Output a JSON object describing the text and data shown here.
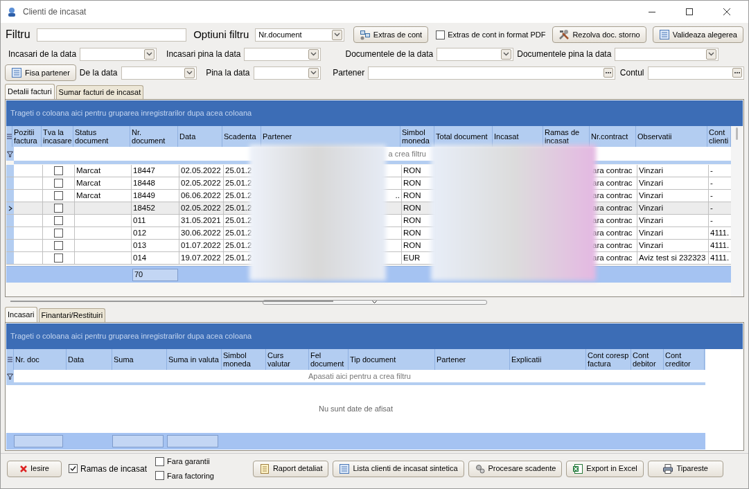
{
  "window": {
    "title": "Clienti de incasat"
  },
  "filter_bar": {
    "filter_label": "Filtru",
    "options_label": "Optiuni filtru",
    "options_value": "Nr.document",
    "statement_button": "Extras de cont",
    "pdf_checkbox": {
      "label": "Extras de cont in format PDF",
      "checked": false
    },
    "storno_button": "Rezolva doc. storno",
    "validate_button": "Valideaza alegerea"
  },
  "date_filters": [
    {
      "label": "Incasari de la data"
    },
    {
      "label": "Incasari pina la data"
    },
    {
      "label": "Documentele de la data"
    },
    {
      "label": "Documentele pina la data"
    }
  ],
  "partner_bar": {
    "partner_card_button": "Fisa partener",
    "from_label": "De la data",
    "to_label": "Pina la data",
    "partner_label": "Partener",
    "account_label": "Contul"
  },
  "top_tabs": [
    {
      "label": "Detalii facturi",
      "selected": true
    },
    {
      "label": "Sumar facturi de incasat",
      "selected": false
    }
  ],
  "invoices_grid": {
    "group_panel": "Trageti o coloana aici pentru gruparea inregistrarilor dupa acea coloana",
    "filter_hint_visible": "a  crea filtru",
    "columns": [
      {
        "label": "Pozitii factura"
      },
      {
        "label": "Tva la incasare"
      },
      {
        "label": "Status document"
      },
      {
        "label": "Nr. document"
      },
      {
        "label": "Data"
      },
      {
        "label": "Scadenta"
      },
      {
        "label": "Partener"
      },
      {
        "label": "Simbol moneda"
      },
      {
        "label": "Total document"
      },
      {
        "label": "Incasat"
      },
      {
        "label": "Ramas de incasat"
      },
      {
        "label": "Nr.contract"
      },
      {
        "label": "Observatii"
      },
      {
        "label": "Cont clienti"
      }
    ],
    "rows": [
      {
        "selected": false,
        "vat_on_collection": false,
        "status": "Marcat",
        "nr_document": "18447",
        "date": "02.05.2022",
        "due": "25.01.2",
        "currency": "RON",
        "contract": "ara contrac",
        "notes": "Vinzari",
        "account": "-"
      },
      {
        "selected": false,
        "vat_on_collection": false,
        "status": "Marcat",
        "nr_document": "18448",
        "date": "02.05.2022",
        "due": "25.01.2",
        "currency": "RON",
        "contract": "ara contrac",
        "notes": "Vinzari",
        "account": "-"
      },
      {
        "selected": false,
        "vat_on_collection": false,
        "status": "Marcat",
        "nr_document": "18449",
        "date": "06.06.2022",
        "due": "25.01.2",
        "partner": "..",
        "currency": "RON",
        "contract": "ara contrac",
        "notes": "Vinzari",
        "account": "-"
      },
      {
        "selected": true,
        "vat_on_collection": false,
        "nr_document": "18452",
        "date": "02.05.2022",
        "due": "25.01.2",
        "currency": "RON",
        "contract": "ara contrac",
        "notes": "Vinzari",
        "account": "-"
      },
      {
        "selected": false,
        "vat_on_collection": false,
        "nr_document": "011",
        "date": "31.05.2021",
        "due": "25.01.2",
        "currency": "RON",
        "contract": "ara contrac",
        "notes": "Vinzari",
        "account": "-"
      },
      {
        "selected": false,
        "vat_on_collection": false,
        "nr_document": "012",
        "date": "30.06.2022",
        "due": "25.01.2",
        "currency": "RON",
        "contract": "ara contrac",
        "notes": "Vinzari",
        "account": "4111."
      },
      {
        "selected": false,
        "vat_on_collection": false,
        "nr_document": "013",
        "date": "01.07.2022",
        "due": "25.01.2",
        "currency": "RON",
        "contract": "ara contrac",
        "notes": "Vinzari",
        "account": "4111."
      },
      {
        "selected": false,
        "vat_on_collection": false,
        "nr_document": "014",
        "date": "19.07.2022",
        "due": "25.01.2",
        "currency": "EUR",
        "contract": "ara contrac",
        "notes": "Aviz test si 232323",
        "account": "4111."
      }
    ],
    "footer_count": "70"
  },
  "bottom_tabs": [
    {
      "label": "Incasari",
      "selected": true
    },
    {
      "label": "Finantari/Restituiri",
      "selected": false
    }
  ],
  "payments_grid": {
    "group_panel": "Trageti o coloana aici pentru gruparea inregistrarilor dupa acea coloana",
    "columns": [
      {
        "label": "Nr. doc"
      },
      {
        "label": "Data"
      },
      {
        "label": "Suma"
      },
      {
        "label": "Suma in valuta"
      },
      {
        "label": "Simbol moneda"
      },
      {
        "label": "Curs valutar"
      },
      {
        "label": "Fel document"
      },
      {
        "label": "Tip document"
      },
      {
        "label": "Partener"
      },
      {
        "label": "Explicatii"
      },
      {
        "label": "Cont coresp factura"
      },
      {
        "label": "Cont debitor"
      },
      {
        "label": "Cont creditor"
      }
    ],
    "filter_hint": "Apasati aici pentru a  crea filtru",
    "empty_message": "Nu sunt date de afisat"
  },
  "bottom_bar": {
    "exit_button": "Iesire",
    "checkboxes": [
      {
        "label": "Ramas de incasat",
        "checked": true
      },
      {
        "label": "Fara garantii",
        "checked": false
      },
      {
        "label": "Fara factoring",
        "checked": false
      }
    ],
    "buttons": [
      {
        "label": "Raport detaliat",
        "kind": "report"
      },
      {
        "label": "Lista clienti de incasat sintetica",
        "kind": "list"
      },
      {
        "label": "Procesare scadente",
        "kind": "gears"
      },
      {
        "label": "Export in Excel",
        "kind": "excel"
      },
      {
        "label": "Tipareste",
        "kind": "print"
      }
    ]
  }
}
